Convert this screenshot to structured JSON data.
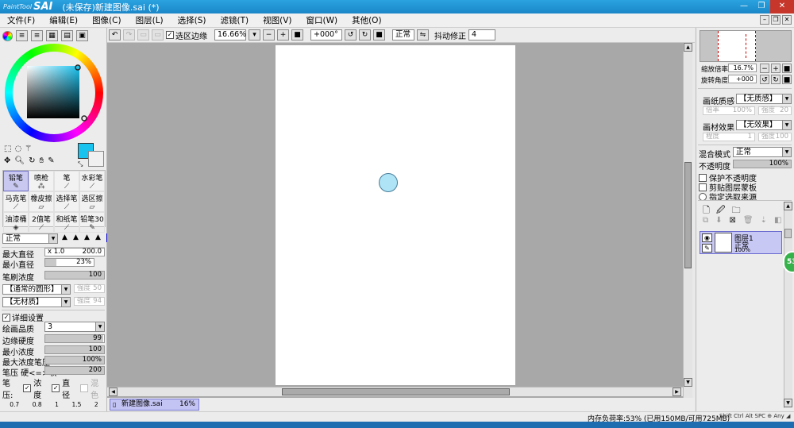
{
  "window": {
    "logo_small": "PaintTool",
    "logo_big": "SAI",
    "title": "(未保存)新建图像.sai (*)",
    "controls": {
      "minimize": "—",
      "maximize": "❐",
      "close": "✕"
    }
  },
  "menu": [
    "文件(F)",
    "编辑(E)",
    "图像(C)",
    "图层(L)",
    "选择(S)",
    "滤镜(T)",
    "视图(V)",
    "窗口(W)",
    "其他(O)"
  ],
  "toolbar": {
    "selection_edge": "选区边缘",
    "zoom": "16.66%",
    "rotation": "+000°",
    "blend": "正常",
    "stabilizer_label": "抖动修正",
    "stabilizer_value": "4"
  },
  "colors": {
    "accent": "#2aa3e0",
    "primary": "#19c3f0",
    "cursor": "#aee4f6",
    "selected": "#c8c8f0"
  },
  "tools": [
    {
      "label": "铅笔",
      "icon": "pencil-icon",
      "selected": true
    },
    {
      "label": "喷枪",
      "icon": "airbrush-icon"
    },
    {
      "label": "笔",
      "icon": "brush-icon"
    },
    {
      "label": "水彩笔",
      "icon": "watercolor-icon"
    },
    {
      "label": "马克笔",
      "icon": "marker-icon"
    },
    {
      "label": "橡皮擦",
      "icon": "eraser-icon"
    },
    {
      "label": "选择笔",
      "icon": "select-pen-icon"
    },
    {
      "label": "选区擦",
      "icon": "select-eraser-icon"
    },
    {
      "label": "油漆桶",
      "icon": "bucket-icon"
    },
    {
      "label": "2值笔",
      "icon": "binary-pen-icon"
    },
    {
      "label": "和纸笔",
      "icon": "washi-pen-icon"
    },
    {
      "label": "铅笔30",
      "icon": "pencil30-icon"
    }
  ],
  "brush": {
    "mode": "正常",
    "max_size_label": "最大直径",
    "max_size_mult": "x 1.0",
    "max_size_value": "200.0",
    "min_size_label": "最小直径",
    "min_size_value": "23%",
    "density_label": "笔刷浓度",
    "density_value": "100",
    "shape": "【通常的圆形】",
    "shape_strength_label": "强度",
    "shape_strength": "50",
    "texture": "【无材质】",
    "texture_strength_label": "强度",
    "texture_strength": "94",
    "detail_label": "详细设置",
    "quality_label": "绘画品质",
    "quality_value": "3",
    "edge_hardness_label": "边缘硬度",
    "edge_hardness_value": "99",
    "min_density_label": "最小浓度",
    "min_density_value": "100",
    "max_pressure_label": "最大浓度笔压",
    "max_pressure_value": "100%",
    "pressure_hardness_label": "笔压 硬<=>软",
    "pressure_hardness_value": "200",
    "pressure_label": "笔压:",
    "pressure_density": "浓度",
    "pressure_size": "直径",
    "pressure_blend": "混色",
    "size_presets": [
      "0.7",
      "0.8",
      "1",
      "1.5",
      "2"
    ]
  },
  "navigator": {
    "zoom_label": "缩放倍率",
    "zoom_value": "16.7%",
    "angle_label": "旋转角度",
    "angle_value": "+000"
  },
  "layer_panel": {
    "paper_texture_label": "画纸质感",
    "paper_texture_value": "【无质感】",
    "paper_scale_label": "倍率",
    "paper_scale_value": "100%",
    "paper_strength_label": "强度",
    "paper_strength_value": "20",
    "paper_effect_label": "画材效果",
    "paper_effect_value": "【无效果】",
    "effect_degree_label": "程度",
    "effect_degree_value": "1",
    "effect_strength_label": "强度",
    "effect_strength_value": "100",
    "blend_mode_label": "混合模式",
    "blend_mode_value": "正常",
    "opacity_label": "不透明度",
    "opacity_value": "100%",
    "protect_opacity": "保护不透明度",
    "clipping": "剪贴图层蒙板",
    "selection_source": "指定选取来源",
    "layer_name": "图层1",
    "layer_mode": "正常",
    "layer_opacity": "100%"
  },
  "document_tab": {
    "name": "新建图像.sai",
    "zoom": "16%"
  },
  "status": {
    "memory": "内存负荷率:53% (已用150MB/可用725MB)",
    "keys": "Shift Ctrl Alt SPC ⊕ Any ◢"
  },
  "badge": "53"
}
